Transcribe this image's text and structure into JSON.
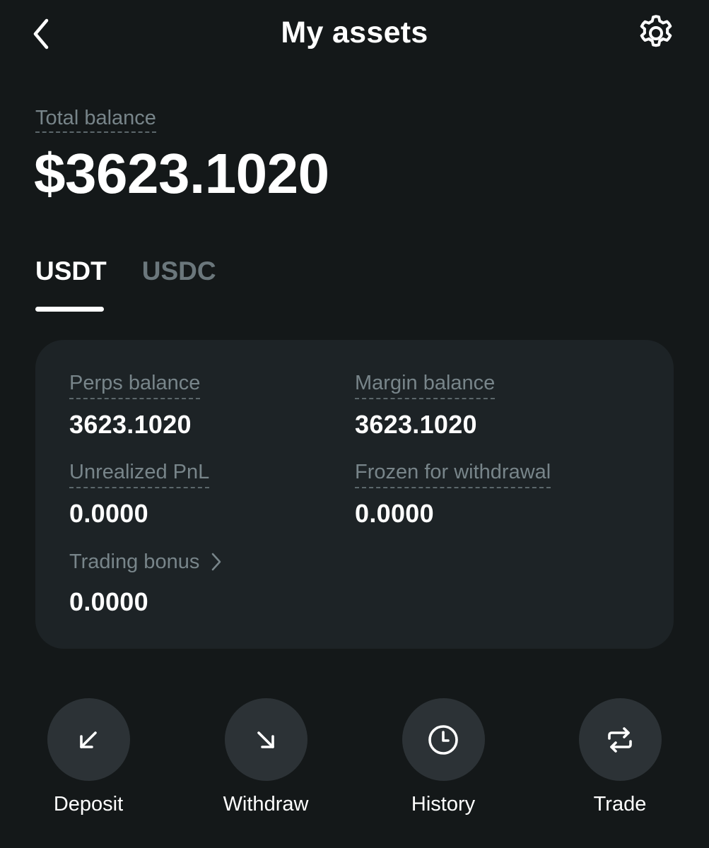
{
  "header": {
    "title": "My assets"
  },
  "total": {
    "label": "Total balance",
    "value": "$3623.1020"
  },
  "tabs": [
    {
      "label": "USDT",
      "active": true
    },
    {
      "label": "USDC",
      "active": false
    }
  ],
  "card": {
    "perps": {
      "label": "Perps balance",
      "value": "3623.1020"
    },
    "margin": {
      "label": "Margin balance",
      "value": "3623.1020"
    },
    "unrealized": {
      "label": "Unrealized PnL",
      "value": "0.0000"
    },
    "frozen": {
      "label": "Frozen for withdrawal",
      "value": "0.0000"
    },
    "bonus": {
      "label": "Trading bonus",
      "value": "0.0000"
    }
  },
  "actions": [
    {
      "label": "Deposit",
      "icon": "arrow-down-left-icon"
    },
    {
      "label": "Withdraw",
      "icon": "arrow-down-right-icon"
    },
    {
      "label": "History",
      "icon": "clock-icon"
    },
    {
      "label": "Trade",
      "icon": "swap-arrows-icon"
    }
  ],
  "colors": {
    "background": "#141819",
    "card": "#1d2326",
    "muted_text": "#78858a",
    "action_circle": "#2c3236"
  }
}
